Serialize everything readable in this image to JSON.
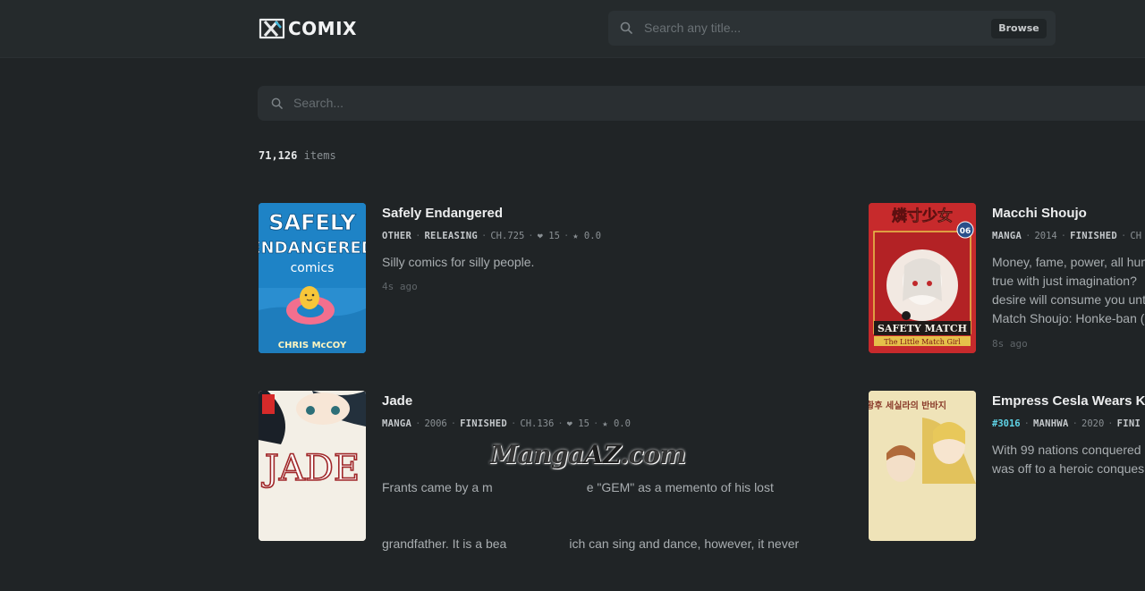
{
  "header": {
    "logo_text": "COMIX",
    "search_placeholder": "Search any title...",
    "browse_label": "Browse"
  },
  "search": {
    "placeholder": "Search..."
  },
  "results": {
    "count": "71,126",
    "count_label": "items"
  },
  "items": [
    {
      "title": "Safely Endangered",
      "type": "OTHER",
      "status": "RELEASING",
      "chapter": "CH.725",
      "likes": "15",
      "rating": "0.0",
      "description": "Silly comics for silly people.",
      "updated": "4s ago",
      "cover": {
        "line1": "SAFELY",
        "line2": "ENDANGERED",
        "line3": "comics",
        "author": "CHRIS McCOY",
        "bg": "#1f86c9"
      }
    },
    {
      "title": "Macchi Shoujo",
      "type": "MANGA",
      "year": "2014",
      "status": "FINISHED",
      "chapter": "CH",
      "description_lines": [
        "Money, fame, power, all hum",
        "true with just imagination?",
        "desire will consume you unt",
        "Match Shoujo: Honke-ban ("
      ],
      "updated": "8s ago",
      "cover": {
        "top_text": "燐寸少女",
        "bottom_text": "SAFETY MATCH",
        "subtitle": "The Little Match Girl",
        "volume": "06",
        "bg": "#c0282b"
      }
    },
    {
      "title": "Jade",
      "type": "MANGA",
      "year": "2006",
      "status": "FINISHED",
      "chapter": "CH.136",
      "likes": "15",
      "rating": "0.0",
      "description_lines": [
        "Frants came by a m                           e \"GEM\" as a memento of his lost",
        "grandfather. It is a bea                  ich can sing and dance, however, it never"
      ],
      "cover": {
        "title_text": "JADE",
        "bg": "#f1ede4"
      }
    },
    {
      "title": "Empress Cesla Wears Kn",
      "rank": "#3016",
      "type": "MANHWA",
      "year": "2020",
      "status": "FINI",
      "description_lines": [
        "With 99 nations conquered",
        "was off to a heroic conques"
      ],
      "cover": {
        "title_text": "황후 세실라의 반바지",
        "bg": "#e6d8a8"
      }
    }
  ],
  "watermark": {
    "part1": "Manga",
    "part2": "AZ",
    "part3": ".com"
  },
  "colors": {
    "background": "#202426",
    "topbar": "#252a2c",
    "accent": "#5fd3e6",
    "text": "#ecedee",
    "muted": "#8a9094"
  },
  "icons": {
    "search": "search-icon",
    "likes": "heart-icon",
    "rating": "star-icon",
    "logo": "comix-logo-icon"
  }
}
